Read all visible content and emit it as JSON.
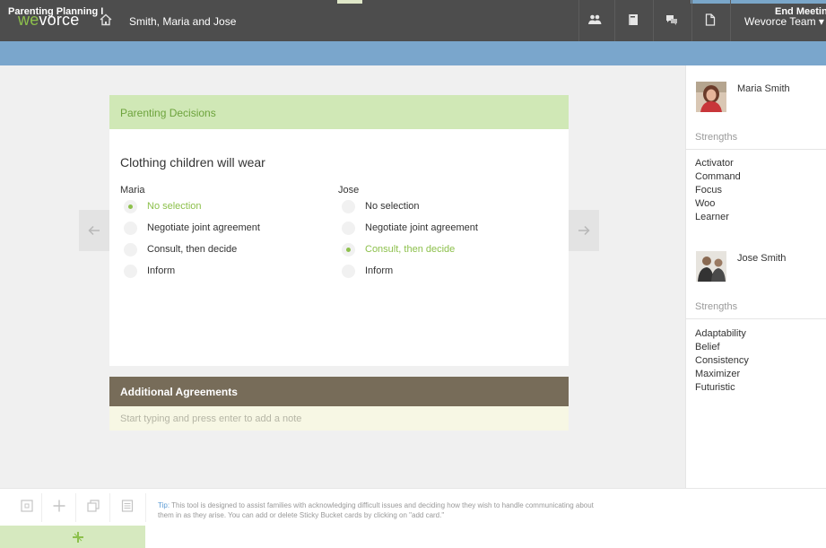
{
  "header": {
    "logo_prefix": "we",
    "logo_suffix": "vorce",
    "case_name": "Smith, Maria and Jose",
    "team_menu": "Wevorce Team ▾",
    "icons": [
      "home-icon",
      "people-icon",
      "notebook-icon",
      "chat-icon",
      "document-icon"
    ]
  },
  "subheader": {
    "title": "Parenting Planning I",
    "end_meeting": "End Meeting"
  },
  "card": {
    "header_title": "Parenting Decisions",
    "question": "Clothing children will wear",
    "people": [
      {
        "name": "Maria",
        "options": [
          {
            "label": "No selection",
            "selected": true
          },
          {
            "label": "Negotiate joint agreement",
            "selected": false
          },
          {
            "label": "Consult, then decide",
            "selected": false
          },
          {
            "label": "Inform",
            "selected": false
          }
        ]
      },
      {
        "name": "Jose",
        "options": [
          {
            "label": "No selection",
            "selected": false
          },
          {
            "label": "Negotiate joint agreement",
            "selected": false
          },
          {
            "label": "Consult, then decide",
            "selected": true
          },
          {
            "label": "Inform",
            "selected": false
          }
        ]
      }
    ]
  },
  "additional": {
    "title": "Additional Agreements",
    "placeholder": "Start typing and press enter to add a note"
  },
  "profiles": [
    {
      "name": "Maria Smith",
      "strengths_label": "Strengths",
      "strengths": [
        "Activator",
        "Command",
        "Focus",
        "Woo",
        "Learner"
      ]
    },
    {
      "name": "Jose Smith",
      "strengths_label": "Strengths",
      "strengths": [
        "Adaptability",
        "Belief",
        "Consistency",
        "Maximizer",
        "Futuristic"
      ]
    }
  ],
  "footer": {
    "tip_label": "Tip:",
    "tip_text": " This tool is designed to assist families with acknowledging difficult issues and deciding how they wish to handle communicating about them in as they arise. You can add or delete Sticky Bucket cards by clicking on \"add card.\"",
    "tools": [
      "fullscreen-icon",
      "add-icon",
      "copy-icon",
      "list-icon"
    ]
  },
  "colors": {
    "topbar": "#4d4d4d",
    "subbar": "#7aa6cc",
    "brand_green": "#8dc04c",
    "card_header": "#d0e8b6",
    "additional_header": "#776c59"
  }
}
